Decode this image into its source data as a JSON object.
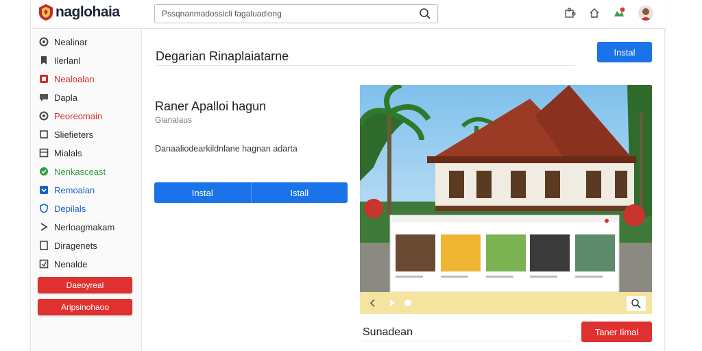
{
  "header": {
    "logo_text": "naglohaia",
    "search_value": "Pssqnanmadossicli fagaluadiong",
    "icons": [
      "search-icon",
      "puzzle-icon",
      "home-icon",
      "notification-icon",
      "avatar"
    ]
  },
  "sidebar": {
    "items": [
      {
        "label": "Nealinar",
        "icon": "circle-icon",
        "color": "#2b2b2b"
      },
      {
        "label": "Ilerlanl",
        "icon": "bookmark-icon",
        "color": "#2b2b2b"
      },
      {
        "label": "Nealoalan",
        "icon": "flag-icon",
        "color": "#d62b2b"
      },
      {
        "label": "Dapla",
        "icon": "chat-icon",
        "color": "#2b2b2b"
      },
      {
        "label": "Peoreomain",
        "icon": "globe-icon",
        "color": "#d62b2b"
      },
      {
        "label": "Sliefieters",
        "icon": "square-icon",
        "color": "#2b2b2b"
      },
      {
        "label": "Mialals",
        "icon": "grid-icon",
        "color": "#2b2b2b"
      },
      {
        "label": "Nenkasceast",
        "icon": "check-icon",
        "color": "#2e9d3d"
      },
      {
        "label": "Remoalan",
        "icon": "download-icon",
        "color": "#1a5fc8"
      },
      {
        "label": "Depilals",
        "icon": "shield-icon",
        "color": "#1a5fc8"
      },
      {
        "label": "Nerloagmakam",
        "icon": "menu-icon",
        "color": "#2b2b2b"
      },
      {
        "label": "Diragenets",
        "icon": "document-icon",
        "color": "#2b2b2b"
      },
      {
        "label": "Nenalde",
        "icon": "tag-icon",
        "color": "#2b2b2b"
      }
    ],
    "buttons": [
      "Daeoyreal",
      "Aripsinohaoo"
    ]
  },
  "main": {
    "page_title": "Degarian Rinaplaiatarne",
    "top_install": "Instal",
    "app_name": "Raner Apalloi hagun",
    "app_sub": "Gianalaus",
    "app_desc": "Danaaliodearkildnlane hagnan adarta",
    "split_left": "Instal",
    "split_right": "Istall",
    "section_title": "Sunadean",
    "red_install": "Taner Iimal"
  },
  "colors": {
    "accent": "#1a73e8",
    "danger": "#e03131",
    "gallery_bar": "#f5e3a0"
  }
}
